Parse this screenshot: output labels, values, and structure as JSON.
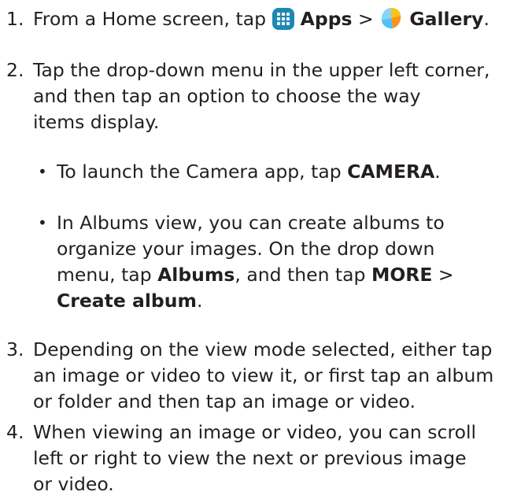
{
  "steps": [
    {
      "number": "1.",
      "parts": [
        {
          "t": "From a Home screen, tap ",
          "b": false
        },
        {
          "icon": "apps-icon"
        },
        {
          "t": " Apps",
          "b": true
        },
        {
          "t": " > ",
          "b": false
        },
        {
          "icon": "gallery-icon"
        },
        {
          "t": " Gallery",
          "b": true
        },
        {
          "t": ".",
          "b": false
        }
      ]
    },
    {
      "number": "2.",
      "lines": [
        "Tap the drop-down menu in the upper left corner,",
        "and then tap an option to choose the way",
        "items display."
      ]
    },
    {
      "number": "3.",
      "lines": [
        "Depending on the view mode selected, either tap",
        "an image or video to view it, or first tap an album",
        "or folder and then tap an image or video."
      ]
    },
    {
      "number": "4.",
      "lines": [
        "When viewing an image or video, you can scroll",
        "left or right to view the next or previous image",
        "or video."
      ]
    }
  ],
  "bullets": [
    {
      "symbol": "•",
      "lines": [
        [
          {
            "t": "To launch the Camera app, tap ",
            "b": false
          },
          {
            "t": "CAMERA",
            "b": true
          },
          {
            "t": ".",
            "b": false
          }
        ]
      ]
    },
    {
      "symbol": "•",
      "lines": [
        [
          {
            "t": "In Albums view, you can create albums to",
            "b": false
          }
        ],
        [
          {
            "t": "organize your images. On the drop down",
            "b": false
          }
        ],
        [
          {
            "t": "menu, tap ",
            "b": false
          },
          {
            "t": "Albums",
            "b": true
          },
          {
            "t": ", and then tap ",
            "b": false
          },
          {
            "t": "MORE",
            "b": true
          },
          {
            "t": " >",
            "b": false
          }
        ],
        [
          {
            "t": "Create album",
            "b": true
          },
          {
            "t": ".",
            "b": false
          }
        ]
      ]
    }
  ],
  "icons": {
    "apps_color": "#1e88b5",
    "gallery_colors": [
      "#f5c518",
      "#f7941d",
      "#4fc3f7"
    ]
  }
}
